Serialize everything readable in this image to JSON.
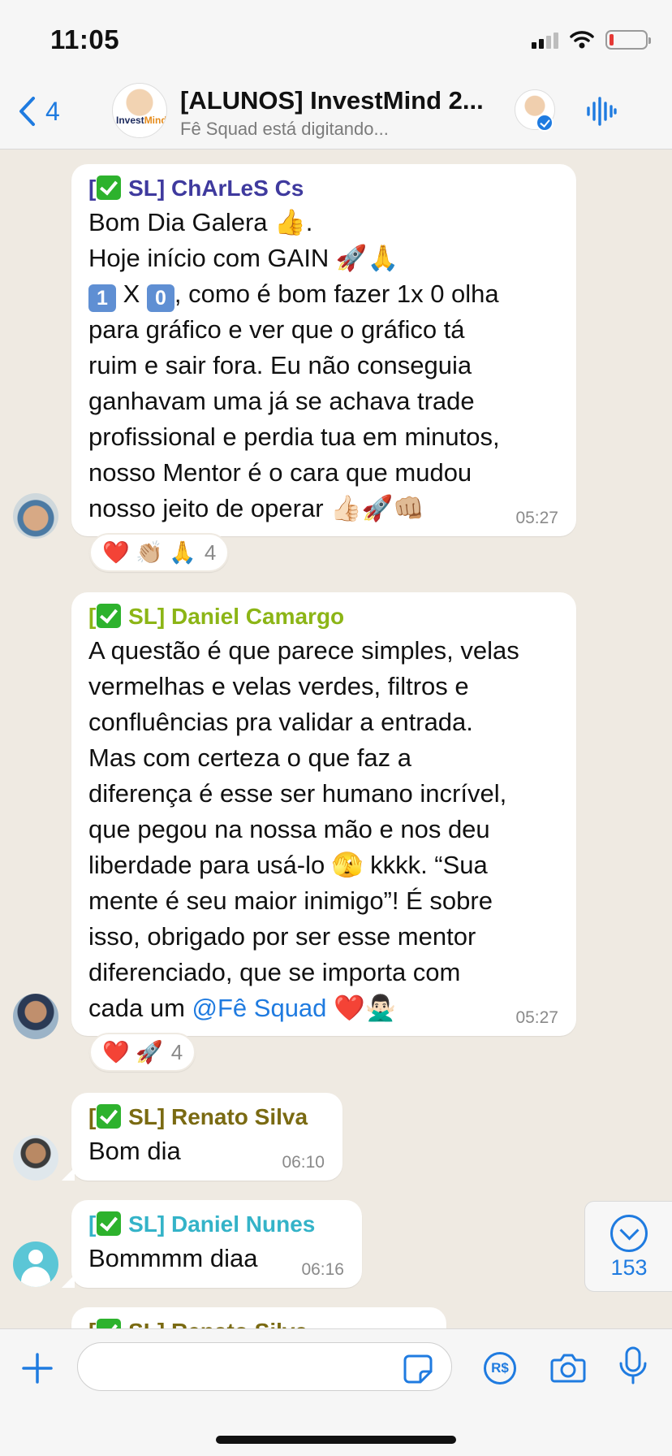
{
  "status_bar": {
    "time": "11:05"
  },
  "header": {
    "back_count": "4",
    "title": "[ALUNOS] InvestMind 2...",
    "subtitle": "Fê Squad está digitando...",
    "logo_text_1": "Invest",
    "logo_text_2": "Mind"
  },
  "messages": [
    {
      "sender": "SL] ChArLeS Cs",
      "sender_color": "#3f3a9e",
      "lines": [
        "Bom Dia Galera 👍.",
        "Hoje início com GAIN 🚀🙏",
        ", como é bom fazer 1x 0 olha\npara gráfico e ver que o gráfico tá\nruim e sair fora. Eu não conseguia\nganhavam uma já se achava trade\nprofissional e perdia tua em minutos,\nnosso Mentor é o cara que mudou\nnosso jeito de operar 👍🏻🚀👊🏼"
      ],
      "keycap_1": "1",
      "keycap_mid": " X ",
      "keycap_2": "0",
      "time": "05:27",
      "reactions": "❤️ 👏🏼 🙏",
      "reaction_count": "4"
    },
    {
      "sender": "SL] Daniel Camargo",
      "sender_color": "#8cb516",
      "text": "A questão é que parece simples, velas\nvermelhas e velas verdes, filtros e\nconfluências pra validar a entrada.\nMas com certeza o que faz a\ndiferença é esse ser humano incrível,\nque pegou na nossa mão e nos deu\nliberdade para usá-lo 🫣 kkkk. “Sua\nmente é seu maior inimigo”! É sobre\nisso, obrigado por ser esse mentor\ndiferenciado, que se importa com\ncada um ",
      "mention": "@Fê Squad",
      "text_end": " ❤️🙅🏻‍♂️",
      "time": "05:27",
      "reactions": "❤️ 🚀",
      "reaction_count": "4"
    },
    {
      "sender": "SL] Renato Silva",
      "sender_color": "#7a6a12",
      "text": "Bom dia",
      "time": "06:10"
    },
    {
      "sender": "SL] Daniel Nunes",
      "sender_color": "#34b3c8",
      "text": "Bommmm diaa",
      "time": "06:16"
    },
    {
      "sender": "SL] Renato Silva",
      "sender_color": "#7a6a12"
    }
  ],
  "scroll_down_count": "153",
  "composer": {
    "pay_label": "R$"
  }
}
